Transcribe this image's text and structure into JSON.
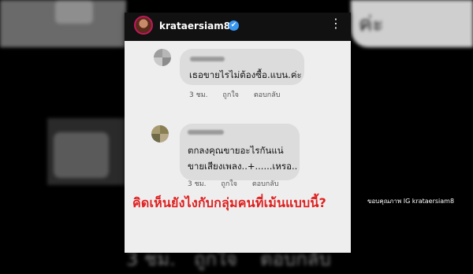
{
  "background": {
    "bottom_time": "3 ชม.",
    "bottom_like": "ถูกใจ",
    "bottom_reply": "ตอบกลับ",
    "right_text": "ค่ะ"
  },
  "post": {
    "username": "krataersiam8",
    "verified_icon": "✔",
    "more_icon": "⋮"
  },
  "comments": [
    {
      "text": "เธอขายไรไม่ต้องซื้อ.แบน.ค่ะ",
      "time": "3 ชม.",
      "like": "ถูกใจ",
      "reply": "ตอบกลับ"
    },
    {
      "text_line1": "ตกลงคุณขายอะไรกันแน่",
      "text_line2": "ขายเสียงเพลง..+......เหรอ..",
      "time": "3 ชม.",
      "like": "ถูกใจ",
      "reply": "ตอบกลับ"
    }
  ],
  "overlay_question": "คิดเห็นยังไงกับกลุ่มคนที่เม้นแบบนี้?",
  "credit": "ขอบคุณภาพ IG krataersiam8",
  "colors": {
    "overlay_text": "#e02020",
    "verified": "#3897f0",
    "card_bg": "#eeeeee",
    "header_bg": "#111111"
  }
}
